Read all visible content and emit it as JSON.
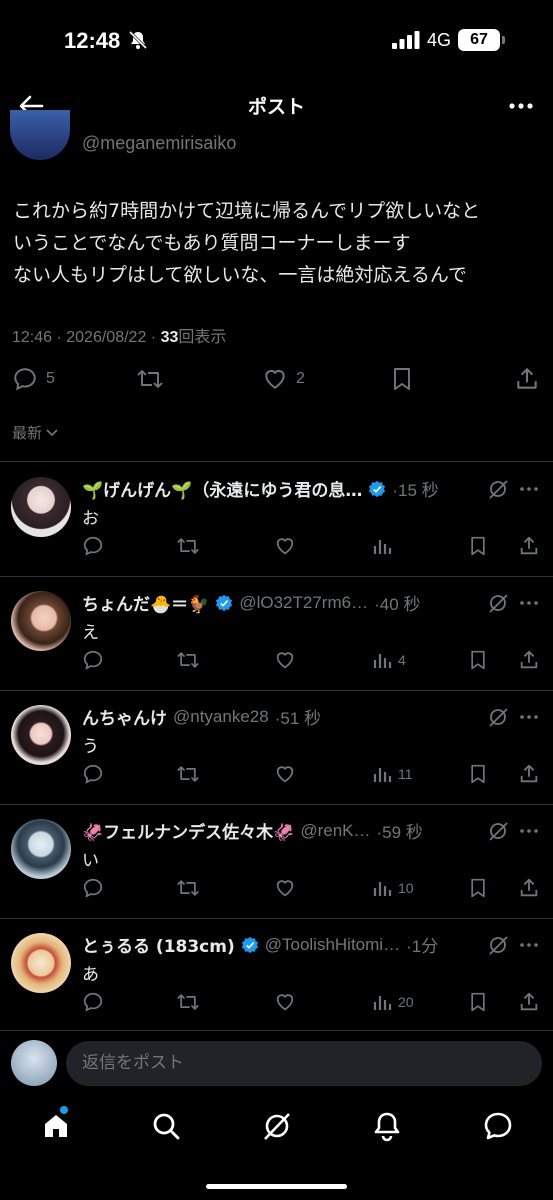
{
  "status_bar": {
    "time": "12:48",
    "network": "4G",
    "battery": "67"
  },
  "nav": {
    "title": "ポスト"
  },
  "post": {
    "handle": "@meganemirisaiko",
    "lines": [
      "これから約7時間かけて辺境に帰るんでリプ欲しいなと",
      "いうことでなんでもあり質問コーナーしまーす",
      "ない人もリプはして欲しいな、一言は絶対応えるんで"
    ],
    "timestamp": "12:46 · 2026/08/22 · ",
    "views": "33",
    "views_label": "回表示",
    "replies": "5",
    "likes": "2"
  },
  "sort_label": "最新",
  "replies": [
    {
      "name": "🌱げんげん🌱（永遠にゆう君の息…",
      "handle": "",
      "verified": true,
      "time": "·15 秒",
      "text": "お",
      "views": ""
    },
    {
      "name": "ちょんだ🐣＝🐓",
      "handle": "@lO32T27rm6…",
      "verified": true,
      "time": "·40 秒",
      "text": "え",
      "views": "4"
    },
    {
      "name": "んちゃんけ",
      "handle": "@ntyanke28",
      "verified": false,
      "time": "·51 秒",
      "text": "う",
      "views": "11"
    },
    {
      "name": "🦑フェルナンデス佐々木🦑",
      "handle": "@renK…",
      "verified": false,
      "time": "·59 秒",
      "text": "い",
      "views": "10"
    },
    {
      "name": "とぅるる (183cm)",
      "handle": "@ToolishHitomi…",
      "verified": true,
      "time": "·1分",
      "text": "あ",
      "views": "20"
    }
  ],
  "composer": {
    "placeholder": "返信をポスト"
  },
  "colors": {
    "background": "#000000",
    "text": "#e7e9ea",
    "muted": "#71767b",
    "accent": "#1d9bf0",
    "divider": "#2f3336"
  }
}
